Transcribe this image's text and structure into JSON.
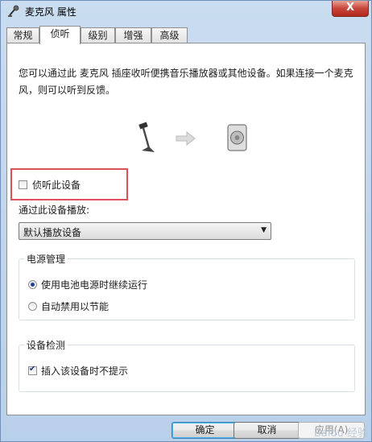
{
  "window": {
    "title": "麦克风 属性",
    "close_label": "X"
  },
  "tabs": [
    "常规",
    "侦听",
    "级别",
    "增强",
    "高级"
  ],
  "active_tab_index": 1,
  "content": {
    "description": "您可以通过此 麦克风 插座收听便携音乐播放器或其他设备。如果连接一个麦克风，则可以听到反馈。",
    "listen_checkbox": {
      "label": "侦听此设备",
      "checked": false
    },
    "playback_label": "通过此设备播放:",
    "playback_select": {
      "value": "默认播放设备"
    },
    "power": {
      "title": "电源管理",
      "options": [
        {
          "label": "使用电池电源时继续运行",
          "checked": true
        },
        {
          "label": "自动禁用以节能",
          "checked": false
        }
      ]
    },
    "detect": {
      "title": "设备检测",
      "checkbox": {
        "label": "插入该设备时不提示",
        "checked": true
      }
    }
  },
  "buttons": {
    "ok": "确定",
    "cancel": "取消",
    "apply": "应用(A)"
  },
  "watermark": "Baidu 经验",
  "colors": {
    "highlight": "#e0505a",
    "window": "#c9dcf0",
    "panel": "#ffffff"
  }
}
